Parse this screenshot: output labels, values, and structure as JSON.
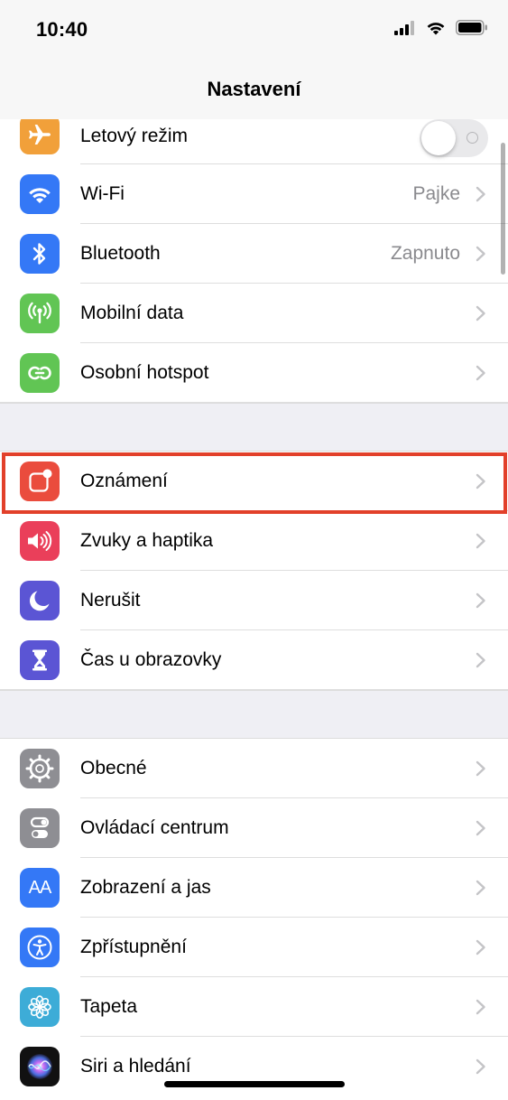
{
  "status_bar": {
    "time": "10:40"
  },
  "nav": {
    "title": "Nastavení"
  },
  "colors": {
    "highlight_border": "#e2402a",
    "airplane": "#f1a03a",
    "wifi": "#3478f6",
    "bluetooth": "#3478f6",
    "cellular": "#61c554",
    "hotspot": "#61c554",
    "notifications": "#ea4c3d",
    "sounds": "#ea3f5a",
    "dnd": "#5b55d4",
    "screen_time": "#5b55d4",
    "general": "#8e8e93",
    "control_center": "#8e8e93",
    "display": "#3478f6",
    "accessibility": "#3478f6",
    "wallpaper": "#3dacd7",
    "siri": "#111111"
  },
  "groups": [
    {
      "items": [
        {
          "label": "Letový režim",
          "icon": "airplane-icon",
          "toggle": false
        },
        {
          "label": "Wi-Fi",
          "icon": "wifi-icon",
          "value": "Pajke"
        },
        {
          "label": "Bluetooth",
          "icon": "bluetooth-icon",
          "value": "Zapnuto"
        },
        {
          "label": "Mobilní data",
          "icon": "antenna-icon"
        },
        {
          "label": "Osobní hotspot",
          "icon": "link-icon"
        }
      ]
    },
    {
      "items": [
        {
          "label": "Oznámení",
          "icon": "notifications-icon",
          "highlighted": true
        },
        {
          "label": "Zvuky a haptika",
          "icon": "speaker-icon"
        },
        {
          "label": "Nerušit",
          "icon": "moon-icon"
        },
        {
          "label": "Čas u obrazovky",
          "icon": "hourglass-icon"
        }
      ]
    },
    {
      "items": [
        {
          "label": "Obecné",
          "icon": "gear-icon"
        },
        {
          "label": "Ovládací centrum",
          "icon": "switches-icon"
        },
        {
          "label": "Zobrazení a jas",
          "icon": "text-size-icon",
          "icon_text": "AA"
        },
        {
          "label": "Zpřístupnění",
          "icon": "accessibility-icon"
        },
        {
          "label": "Tapeta",
          "icon": "flower-icon"
        },
        {
          "label": "Siri a hledání",
          "icon": "siri-icon"
        }
      ]
    }
  ]
}
